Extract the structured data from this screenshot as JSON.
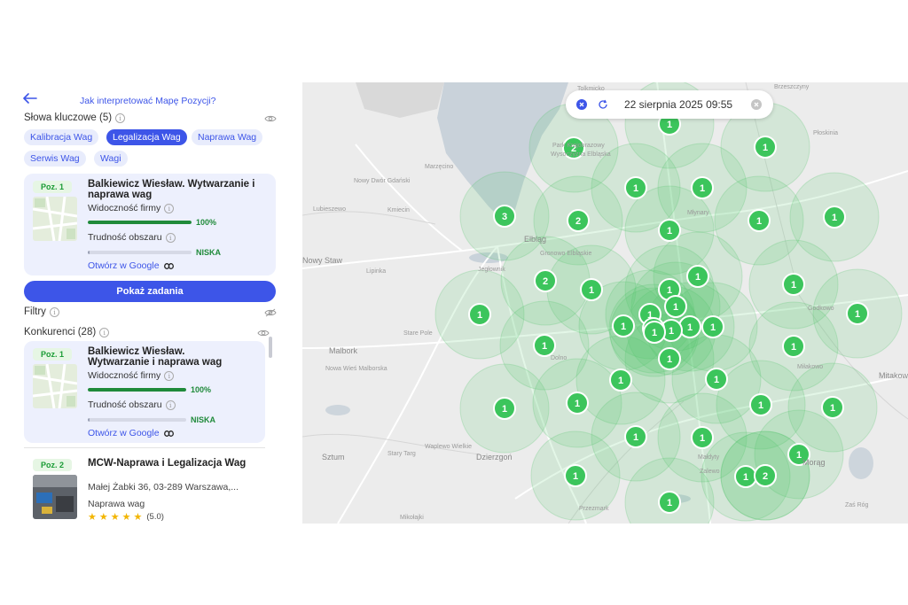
{
  "header": {
    "help_link": "Jak interpretować Mapę Pozycji?"
  },
  "keywords": {
    "title": "Słowa kluczowe (5)",
    "items": [
      "Kalibracja Wag",
      "Legalizacja Wag",
      "Naprawa Wag",
      "Serwis Wag",
      "Wagi"
    ],
    "active_index": 1
  },
  "selected_card": {
    "position": "Poz. 1",
    "title": "Balkiewicz Wiesław. Wytwarzanie i naprawa wag",
    "visibility_label": "Widoczność firmy",
    "visibility_value": "100%",
    "visibility_fraction": 1.0,
    "difficulty_label": "Trudność obszaru",
    "difficulty_value": "NISKA",
    "difficulty_fraction": 0.02,
    "open_link": "Otwórz w Google"
  },
  "show_tasks_button": "Pokaż zadania",
  "filters": {
    "title": "Filtry"
  },
  "competitors": {
    "title": "Konkurenci (28)",
    "items": [
      {
        "position": "Poz. 1",
        "title": "Balkiewicz Wiesław. Wytwarzanie i naprawa wag",
        "visibility_label": "Widoczność firmy",
        "visibility_value": "100%",
        "visibility_fraction": 1.0,
        "difficulty_label": "Trudność obszaru",
        "difficulty_value": "NISKA",
        "difficulty_fraction": 0.02,
        "open_link": "Otwórz w Google"
      },
      {
        "position": "Poz. 2",
        "title": "MCW-Naprawa i Legalizacja Wag",
        "address": "Małej Żabki 36, 03-289 Warszawa,...",
        "category": "Naprawa wag",
        "rating": "(5.0)",
        "stars": 5
      }
    ]
  },
  "map": {
    "date": "22 sierpnia 2025 09:55",
    "colors": {
      "marker": "#3cc55c",
      "circle": "#52c56c",
      "accent": "#3d55e8"
    },
    "places": [
      {
        "name": "Tolkmicko"
      },
      {
        "name": "Park Krajobrazowy"
      },
      {
        "name": "Wysoczyzna Elbląska"
      },
      {
        "name": "Marzęcino"
      },
      {
        "name": "Nowy Dwór Gdański"
      },
      {
        "name": "Lubieszewo"
      },
      {
        "name": "Kmiecin"
      },
      {
        "name": "Elbląg"
      },
      {
        "name": "Gronowo Elbląskie"
      },
      {
        "name": "Jegłownik"
      },
      {
        "name": "Nowy Staw"
      },
      {
        "name": "Lipinka"
      },
      {
        "name": "Stare Pole"
      },
      {
        "name": "Malbork"
      },
      {
        "name": "Nowa Wieś Malborska"
      },
      {
        "name": "Dolno"
      },
      {
        "name": "Sztum"
      },
      {
        "name": "Stary Targ"
      },
      {
        "name": "Waplewo Wielkie"
      },
      {
        "name": "Dzierzgoń"
      },
      {
        "name": "Mikołajki"
      },
      {
        "name": "Młynary"
      },
      {
        "name": "Brzeszczyny"
      },
      {
        "name": "Płoskinia"
      },
      {
        "name": "Godkowo"
      },
      {
        "name": "Morąg"
      },
      {
        "name": "Miłakowo"
      },
      {
        "name": "Mitakowo"
      },
      {
        "name": "Zalewo"
      },
      {
        "name": "Małdyty"
      },
      {
        "name": "Przezmark"
      },
      {
        "name": "Zaś Róg"
      }
    ],
    "markers": [
      {
        "label": "1"
      },
      {
        "label": "2"
      },
      {
        "label": "1"
      },
      {
        "label": "1"
      },
      {
        "label": "1"
      },
      {
        "label": "3"
      },
      {
        "label": "2"
      },
      {
        "label": "1"
      },
      {
        "label": "1"
      },
      {
        "label": "1"
      },
      {
        "label": "2"
      },
      {
        "label": "1"
      },
      {
        "label": "1"
      },
      {
        "label": "1"
      },
      {
        "label": "1"
      },
      {
        "label": "1"
      },
      {
        "label": "1"
      },
      {
        "label": "1"
      },
      {
        "label": "1"
      },
      {
        "label": "1"
      },
      {
        "label": "1"
      },
      {
        "label": "1"
      },
      {
        "label": "1"
      },
      {
        "label": "1"
      },
      {
        "label": "1"
      },
      {
        "label": "1"
      },
      {
        "label": "1"
      },
      {
        "label": "1"
      },
      {
        "label": "1"
      },
      {
        "label": "1"
      },
      {
        "label": "1"
      },
      {
        "label": "1"
      },
      {
        "label": "1"
      },
      {
        "label": "1"
      },
      {
        "label": "1"
      },
      {
        "label": "1"
      },
      {
        "label": "1"
      },
      {
        "label": "1"
      },
      {
        "label": "1"
      },
      {
        "label": "1"
      },
      {
        "label": "2"
      },
      {
        "label": "1"
      }
    ]
  }
}
